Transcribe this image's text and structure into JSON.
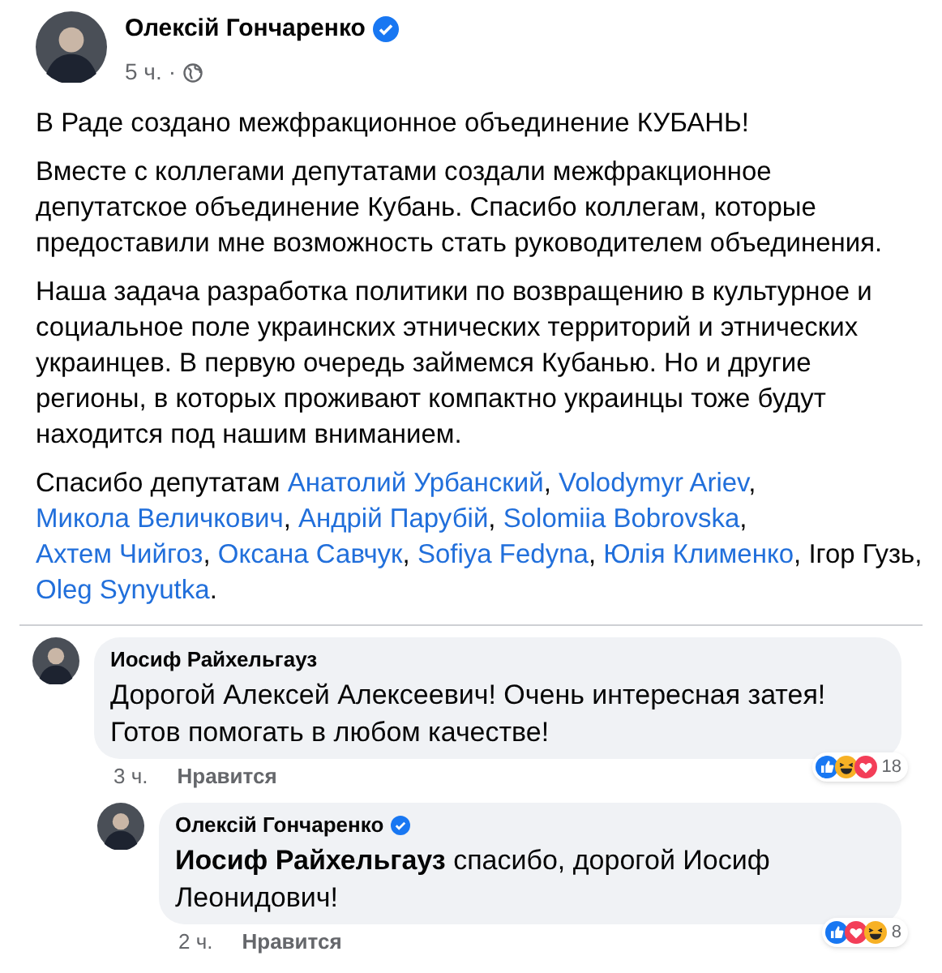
{
  "post": {
    "author": "Олексій Гончаренко",
    "verified": true,
    "time": "5 ч.",
    "audience_separator": "·",
    "paragraphs": [
      "В Раде создано межфракционное объединение КУБАНЬ!",
      "Вместе с коллегами депутатами создали межфракционное депутатское объединение Кубань. Спасибо коллегам, которые предоставили мне возможность стать руководителем объединения.",
      "Наша задача разработка политики по возвращению в культурное и социальное поле украинских этнических территорий и этнических украинцев. В первую очередь займемся Кубанью. Но и другие регионы, в которых проживают компактно украинцы тоже будут находится под нашим вниманием."
    ],
    "thanks": [
      {
        "kind": "text",
        "text": "Спасибо депутатам "
      },
      {
        "kind": "mention",
        "text": "Анатолий Урбанский"
      },
      {
        "kind": "text",
        "text": ", "
      },
      {
        "kind": "mention",
        "text": "Volodymyr Ariev"
      },
      {
        "kind": "text",
        "text": ", "
      },
      {
        "kind": "mention",
        "text": "Микола Величкович"
      },
      {
        "kind": "text",
        "text": ", "
      },
      {
        "kind": "mention",
        "text": "Андрій Парубій"
      },
      {
        "kind": "text",
        "text": ", "
      },
      {
        "kind": "mention",
        "text": "Solomiia Bobrovska"
      },
      {
        "kind": "text",
        "text": ", "
      },
      {
        "kind": "mention",
        "text": "Ахтем Чийгоз"
      },
      {
        "kind": "text",
        "text": ", "
      },
      {
        "kind": "mention",
        "text": "Оксана Савчук"
      },
      {
        "kind": "text",
        "text": ", "
      },
      {
        "kind": "mention",
        "text": "Sofiya Fedyna"
      },
      {
        "kind": "text",
        "text": ", "
      },
      {
        "kind": "mention",
        "text": "Юлія Клименко"
      },
      {
        "kind": "text",
        "text": ", Ігор Гузь, "
      },
      {
        "kind": "mention",
        "text": "Oleg Synyutka"
      },
      {
        "kind": "text",
        "text": "."
      }
    ]
  },
  "comments": [
    {
      "author": "Иосиф Райхельгауз",
      "verified": false,
      "reply": false,
      "text": "Дорогой Алексей Алексеевич! Очень интересная затея! Готов помогать в любом качестве!",
      "time": "3 ч.",
      "like": "Нравится",
      "reactions": [
        {
          "kind": "like"
        },
        {
          "kind": "haha"
        },
        {
          "kind": "love"
        }
      ],
      "reaction_count": "18"
    },
    {
      "author": "Олексій Гончаренко",
      "verified": true,
      "reply": true,
      "text": "**Иосиф Райхельгауз** спасибо, дорогой Иосиф Леонидович!",
      "time": "2 ч.",
      "like": "Нравится",
      "reactions": [
        {
          "kind": "like"
        },
        {
          "kind": "love"
        },
        {
          "kind": "haha"
        }
      ],
      "reaction_count": "8"
    }
  ]
}
